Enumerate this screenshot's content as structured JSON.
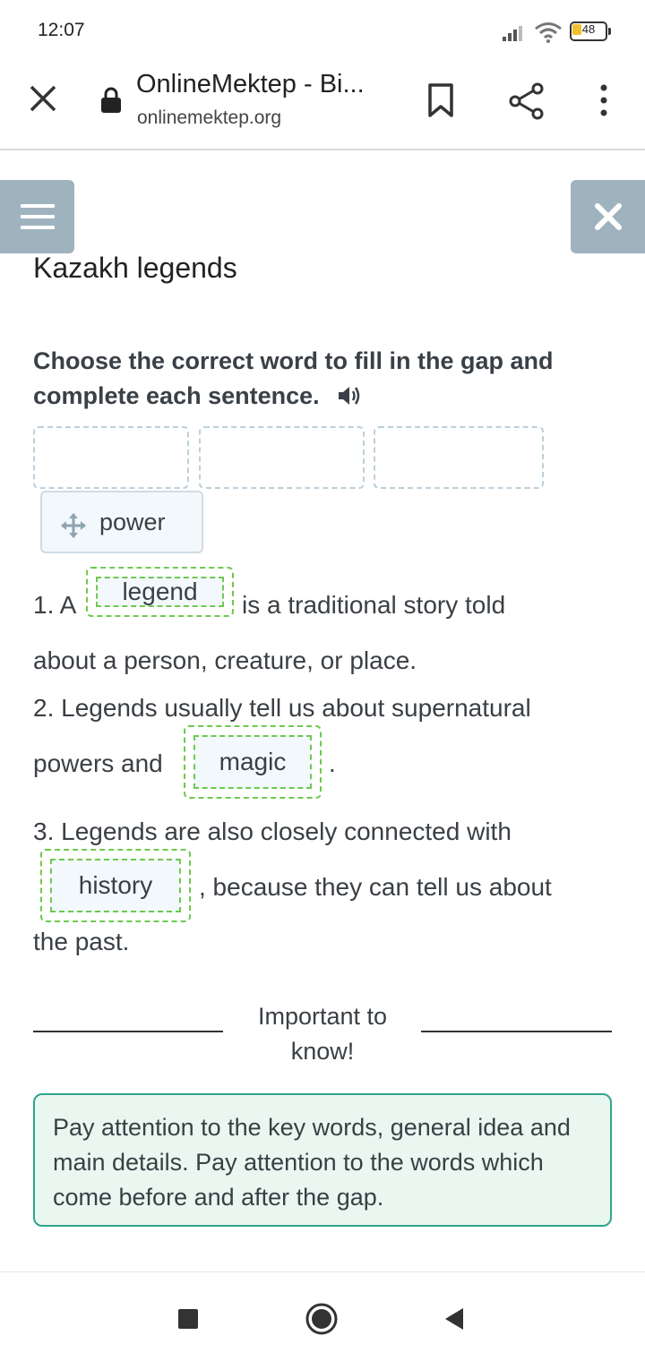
{
  "status_bar": {
    "time": "12:07",
    "battery_level": "48"
  },
  "browser": {
    "page_title": "OnlineMektep - Bi...",
    "url": "onlinemektep.org"
  },
  "lesson": {
    "title": "Kazakh legends",
    "instruction": "Choose the correct word to fill in the gap and complete each sentence.",
    "draggable_word": "power",
    "sentences": {
      "s1_start": "1. A",
      "s1_gap": "legend",
      "s1_after": "is a traditional story told",
      "s1_line2": "about a person, creature, or place.",
      "s2_line1": "2. Legends usually tell us about supernatural",
      "s2_before": "powers and",
      "s2_gap": "magic",
      "s2_after": ".",
      "s3_line1": "3. Legends are also closely connected with",
      "s3_gap": "history",
      "s3_after": ", because they can tell us about",
      "s3_line3": "the past."
    },
    "important_label": "Important to know!",
    "tip": "Pay attention to the key words, general idea and main details. Pay attention to the words which come before and after the gap."
  },
  "colors": {
    "accent_gray_blue": "#9fb3be",
    "gap_border_green": "#6dc94f",
    "tip_border": "#2fa58a",
    "tip_background": "#eaf7f1"
  },
  "icons": [
    "close-icon",
    "lock-icon",
    "bookmark-icon",
    "share-icon",
    "more-vert-icon",
    "menu-icon",
    "close-x-icon",
    "speaker-icon",
    "move-icon",
    "nav-recent-icon",
    "nav-home-icon",
    "nav-back-icon"
  ]
}
